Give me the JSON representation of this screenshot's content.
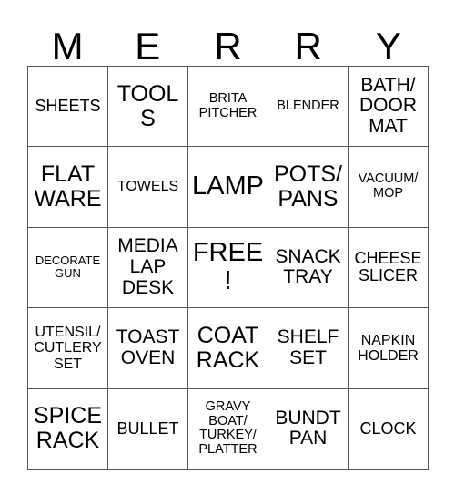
{
  "card": {
    "title_letters": [
      "M",
      "E",
      "R",
      "R",
      "Y"
    ],
    "grid": {
      "columns": 5,
      "rows": 5,
      "cells": [
        {
          "label": "SHEETS",
          "size": "ml"
        },
        {
          "label": "TOOLS",
          "size": "xl"
        },
        {
          "label": "BRITA\nPITCHER",
          "size": "s"
        },
        {
          "label": "BLENDER",
          "size": "s"
        },
        {
          "label": "BATH/\nDOOR\nMAT",
          "size": "l"
        },
        {
          "label": "FLAT\nWARE",
          "size": "xl"
        },
        {
          "label": "TOWELS",
          "size": "m"
        },
        {
          "label": "LAMP",
          "size": "xxl"
        },
        {
          "label": "POTS/\nPANS",
          "size": "xl"
        },
        {
          "label": "VACUUM/\nMOP",
          "size": "s"
        },
        {
          "label": "DECORATE\nGUN",
          "size": "xs"
        },
        {
          "label": "MEDIA\nLAP\nDESK",
          "size": "l"
        },
        {
          "label": "FREE!",
          "size": "xxl"
        },
        {
          "label": "SNACK\nTRAY",
          "size": "l"
        },
        {
          "label": "CHEESE\nSLICER",
          "size": "ml"
        },
        {
          "label": "UTENSIL/\nCUTLERY\nSET",
          "size": "m"
        },
        {
          "label": "TOAST\nOVEN",
          "size": "l"
        },
        {
          "label": "COAT\nRACK",
          "size": "xl"
        },
        {
          "label": "SHELF\nSET",
          "size": "l"
        },
        {
          "label": "NAPKIN\nHOLDER",
          "size": "m"
        },
        {
          "label": "SPICE\nRACK",
          "size": "xl"
        },
        {
          "label": "BULLET",
          "size": "ml"
        },
        {
          "label": "GRAVY\nBOAT/\nTURKEY/\nPLATTER",
          "size": "s"
        },
        {
          "label": "BUNDT\nPAN",
          "size": "l"
        },
        {
          "label": "CLOCK",
          "size": "ml"
        }
      ]
    },
    "colors": {
      "background": "#ffffff",
      "text": "#000000",
      "grid_line": "#555555"
    }
  }
}
